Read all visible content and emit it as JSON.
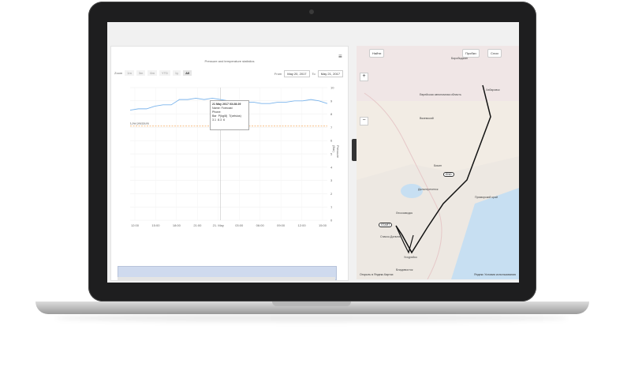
{
  "chart": {
    "title": "Pressure and temperature statistics",
    "menu_icon": "hamburger-menu-icon",
    "zoom_label": "Zoom",
    "zoom_buttons": [
      "1m",
      "3m",
      "6m",
      "YTD",
      "1y",
      "All"
    ],
    "from_label": "From",
    "from_value": "May 20, 2017",
    "to_label": "To",
    "to_value": "May 21, 2017",
    "threshold_label": "Low pressure",
    "y_axis_right_label": "Pressure (Bar)",
    "y_ticks": [
      "10",
      "9",
      "8",
      "7",
      "6",
      "5",
      "4",
      "3",
      "2",
      "1",
      "0"
    ],
    "x_ticks": [
      "12:00",
      "15:00",
      "18:00",
      "21:00",
      "21. May",
      "03:00",
      "06:00",
      "09:00",
      "12:00",
      "15:00"
    ],
    "tooltip": {
      "title": "21 May 2017 03:28:29",
      "name": "Name: Forecast",
      "phone": "Phone:",
      "headers": [
        "Bar",
        "P(kg/8)",
        "T(celsius)"
      ],
      "values": [
        "3.1",
        "P(kg8)",
        "8.3",
        "6"
      ]
    }
  },
  "chart_data": {
    "type": "line",
    "series": [
      {
        "name": "Pressure",
        "values": [
          8.3,
          8.4,
          8.4,
          8.6,
          8.7,
          8.7,
          9.1,
          9.1,
          9.2,
          9.1,
          9.2,
          9.1,
          9.0,
          9.0,
          8.9,
          8.9,
          8.8,
          8.8,
          8.9,
          8.9,
          9.0,
          9.0,
          9.1,
          9.0,
          8.8
        ]
      }
    ],
    "threshold": 7.1,
    "ylim": [
      0,
      10
    ]
  },
  "map": {
    "controls": {
      "find": "Найти",
      "traffic": "Пробки",
      "layers": "Слои"
    },
    "labels": [
      "Биробиджан",
      "Хабаровск",
      "Еврейская автономная область",
      "Приморский край",
      "Вяземский",
      "Бикин",
      "Дальнереченск",
      "Лесозаводск",
      "Спасск-Дальний",
      "Арсеньев",
      "Уссурийск",
      "Владивосток"
    ],
    "markers": {
      "start": "START",
      "mid": "END",
      "end": "END"
    },
    "footer_left": "Открыть в Яндекс.Картах",
    "footer_right": "Яндекс Условия использования"
  }
}
